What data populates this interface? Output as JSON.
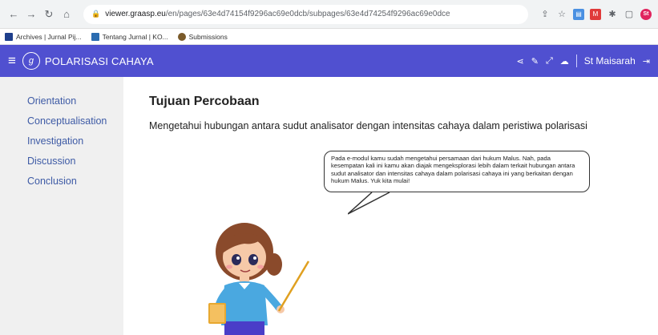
{
  "browser": {
    "url_host": "viewer.graasp.eu",
    "url_path": "/en/pages/63e4d74154f9296ac69e0dcb/subpages/63e4d74254f9296ac69e0dce",
    "profile_initials": "St"
  },
  "bookmarks": [
    {
      "label": "Archives | Jurnal Pij..."
    },
    {
      "label": "Tentang Jurnal | KO..."
    },
    {
      "label": "Submissions"
    }
  ],
  "header": {
    "title": "POLARISASI CAHAYA",
    "user_name": "St Maisarah"
  },
  "sidebar": {
    "items": [
      {
        "label": "Orientation"
      },
      {
        "label": "Conceptualisation"
      },
      {
        "label": "Investigation"
      },
      {
        "label": "Discussion"
      },
      {
        "label": "Conclusion"
      }
    ]
  },
  "main": {
    "title": "Tujuan Percobaan",
    "description": "Mengetahui hubungan antara sudut analisator dengan intensitas cahaya dalam peristiwa polarisasi",
    "bubble_text": "Pada e-modul kamu sudah mengetahui persamaan dari hukum Malus. Nah, pada kesempatan kali ini kamu akan diajak mengeksplorasi lebih dalam terkait hubungan antara sudut analisator dan intensitas cahaya dalam polarisasi cahaya ini yang berkaitan dengan hukum Malus. Yuk kita mulai!"
  },
  "colors": {
    "header_bg": "#5050d0",
    "sidebar_link": "#3d5aa5",
    "sidebar_bg": "#f0f0f0"
  },
  "icons": [
    "back-icon",
    "forward-icon",
    "reload-icon",
    "home-icon",
    "lock-icon",
    "share-icon",
    "star-icon",
    "menu-icon",
    "share-icon",
    "edit-icon",
    "fullscreen-icon",
    "cloud-icon",
    "logout-icon"
  ]
}
